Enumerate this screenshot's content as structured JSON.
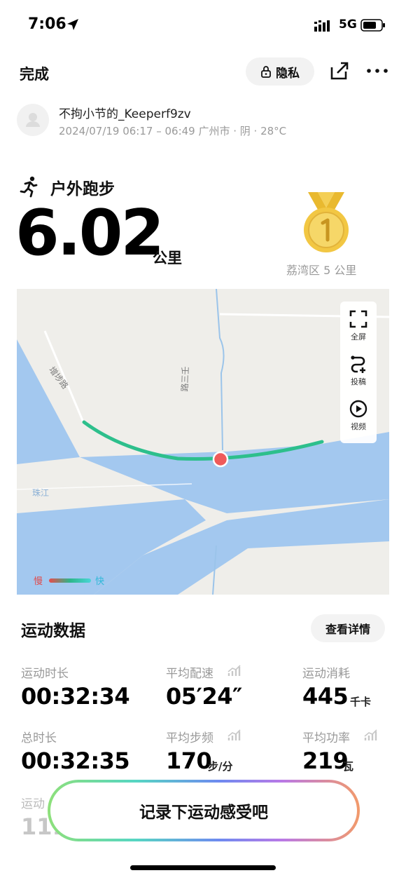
{
  "status_bar": {
    "time": "7:06",
    "network": "5G"
  },
  "nav": {
    "done_label": "完成",
    "privacy_label": "隐私"
  },
  "user": {
    "name": "不拘小节的_Keeperf9zv",
    "meta": "2024/07/19 06:17 – 06:49 广州市 · 阴 · 28°C"
  },
  "workout": {
    "sport": "户外跑步",
    "distance": "6.02",
    "distance_unit": "公里",
    "medal_label": "荔湾区 5 公里"
  },
  "map": {
    "tools": [
      {
        "label": "全屏",
        "icon": "fullscreen-icon"
      },
      {
        "label": "投稿",
        "icon": "route-submit-icon"
      },
      {
        "label": "视频",
        "icon": "play-video-icon"
      }
    ],
    "legend": {
      "slow": "慢",
      "fast": "快"
    },
    "labels": {
      "road1": "增埗路",
      "road2": "路三壬",
      "river": "珠江"
    }
  },
  "stats_section": {
    "title": "运动数据",
    "detail_button": "查看详情"
  },
  "stats": [
    {
      "label": "运动时长",
      "value": "00:32:34",
      "unit": ""
    },
    {
      "label": "平均配速",
      "value": "05′24″",
      "unit": ""
    },
    {
      "label": "运动消耗",
      "value": "445",
      "unit": "千卡"
    },
    {
      "label": "总时长",
      "value": "00:32:35",
      "unit": ""
    },
    {
      "label": "平均步频",
      "value": "170",
      "unit": "步/分"
    },
    {
      "label": "平均功率",
      "value": "219",
      "unit": "瓦"
    }
  ],
  "partial_stat": {
    "label": "运动",
    "value": "111"
  },
  "cta": {
    "label": "记录下运动感受吧"
  },
  "colors": {
    "route": "#2dbf8c",
    "water": "#a3c8ef",
    "land": "#efeeea",
    "marker": "#ef5a5a"
  }
}
